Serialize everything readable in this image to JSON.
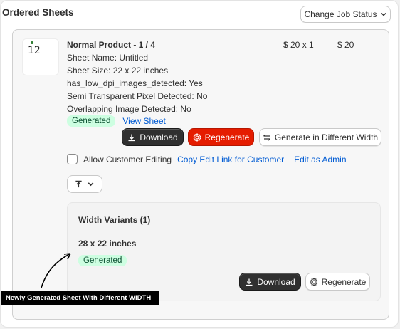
{
  "section": {
    "title": "Ordered Sheets",
    "status_button": "Change Job Status"
  },
  "product": {
    "thumbnail_text": "12",
    "name": "Normal Product - 1 / 4",
    "unit_price": "$ 20 x 1",
    "total": "$ 20",
    "details": [
      "Sheet Name: Untitled",
      "Sheet Size: 22 x 22 inches",
      "has_low_dpi_images_detected: Yes",
      "Semi Transparent Pixel Detected: No",
      "Overlapping Image Detected: No"
    ],
    "status_badge": "Generated",
    "view_link": "View Sheet",
    "download_label": "Download",
    "regenerate_label": "Regenerate",
    "diff_width_label": "Generate in Different Width",
    "allow_editing_label": "Allow Customer Editing",
    "copy_link_label": "Copy Edit Link for Customer",
    "edit_admin_label": "Edit as Admin"
  },
  "variants": {
    "title": "Width Variants (1)",
    "size": "28 x 22 inches",
    "status_badge": "Generated",
    "download_label": "Download",
    "regenerate_label": "Regenerate"
  },
  "annotation": {
    "text": "Newly Generated Sheet With Different WIDTH"
  },
  "colors": {
    "dark_button": "#303030",
    "danger_button": "#e51c00",
    "success_badge_bg": "#cdfee1",
    "success_badge_text": "#0c5132",
    "link": "#005bd3"
  }
}
